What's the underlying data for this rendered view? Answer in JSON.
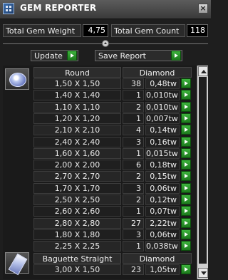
{
  "window": {
    "title": "GEM REPORTER",
    "close_label": "×"
  },
  "totals": {
    "weight_label": "Total Gem Weight",
    "weight_value": "4,75",
    "count_label": "Total Gem Count",
    "count_value": "118"
  },
  "toolbar": {
    "update_label": "Update",
    "save_report_label": "Save Report"
  },
  "round_section": {
    "icon": "round-gem-icon",
    "header_shape": "Round",
    "header_type": "Diamond",
    "rows": [
      {
        "size": "1,50 X 1,50",
        "count": "38",
        "weight": "0,48tw"
      },
      {
        "size": "1,40 X 1,40",
        "count": "1",
        "weight": "0,010tw"
      },
      {
        "size": "1,10 X 1,10",
        "count": "2",
        "weight": "0,010tw"
      },
      {
        "size": "1,20 X 1,20",
        "count": "1",
        "weight": "0,007tw"
      },
      {
        "size": "2,10 X 2,10",
        "count": "4",
        "weight": "0,14tw"
      },
      {
        "size": "2,40 X 2,40",
        "count": "3",
        "weight": "0,16tw"
      },
      {
        "size": "1,60 X 1,60",
        "count": "1",
        "weight": "0,015tw"
      },
      {
        "size": "2,00 X 2,00",
        "count": "6",
        "weight": "0,18tw"
      },
      {
        "size": "2,70 X 2,70",
        "count": "2",
        "weight": "0,15tw"
      },
      {
        "size": "1,70 X 1,70",
        "count": "3",
        "weight": "0,06tw"
      },
      {
        "size": "2,50 X 2,50",
        "count": "2",
        "weight": "0,12tw"
      },
      {
        "size": "2,60 X 2,60",
        "count": "1",
        "weight": "0,07tw"
      },
      {
        "size": "2,80 X 2,80",
        "count": "27",
        "weight": "2,22tw"
      },
      {
        "size": "1,80 X 1,80",
        "count": "3",
        "weight": "0,06tw"
      },
      {
        "size": "2,25 X 2,25",
        "count": "1",
        "weight": "0,038tw"
      }
    ]
  },
  "baguette_section": {
    "icon": "baguette-gem-icon",
    "header_shape": "Baguette Straight",
    "header_type": "Diamond",
    "rows": [
      {
        "size": "3,00 X 1,50",
        "count": "23",
        "weight": "1,05tw"
      }
    ]
  },
  "colors": {
    "accent_green": "#2a9a2a",
    "value_box": "#000000",
    "panel_bg": "#1e1e1e"
  }
}
